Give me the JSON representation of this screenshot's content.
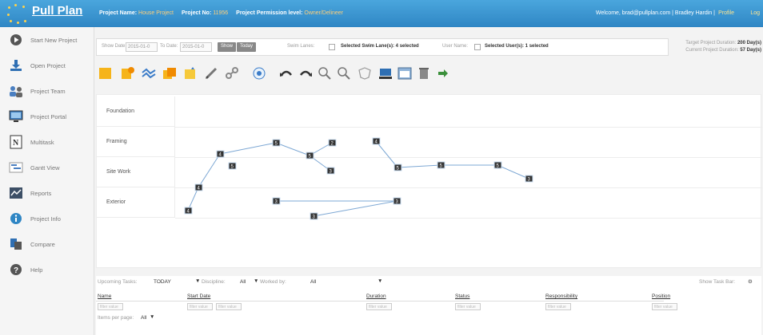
{
  "header": {
    "logo_text": "Pull Plan",
    "project_name_label": "Project Name:",
    "project_name": "House Project",
    "project_no_label": "Project No:",
    "project_no": "11956",
    "permission_label": "Project Permission level:",
    "permission": "Owner/Delineer",
    "welcome": "Welcome, brad@pullplan.com | Bradley Hardin |",
    "profile": "Profile",
    "logout": "Log"
  },
  "sidebar": {
    "items": [
      {
        "label": "Start New Project",
        "icon": "play-icon"
      },
      {
        "label": "Open Project",
        "icon": "download-icon"
      },
      {
        "label": "Project Team",
        "icon": "team-icon"
      },
      {
        "label": "Project Portal",
        "icon": "monitor-icon"
      },
      {
        "label": "Multitask",
        "icon": "multitask-icon"
      },
      {
        "label": "Gantt View",
        "icon": "gantt-icon"
      },
      {
        "label": "Reports",
        "icon": "reports-icon"
      },
      {
        "label": "Project Info",
        "icon": "info-icon"
      },
      {
        "label": "Compare",
        "icon": "compare-icon"
      },
      {
        "label": "Help",
        "icon": "help-icon"
      }
    ]
  },
  "filters": {
    "show_date_label": "Show Date:",
    "from_date": "2015-01-0",
    "to_label": "To Date:",
    "to_date": "2015-01-0",
    "show_btn": "Show",
    "today_btn": "Today",
    "swim_lanes_label": "Swim Lanes:",
    "swim_lanes_selected": "Selected Swim Lane(s): 4 selected",
    "user_names_label": "User Name:",
    "users_selected": "Selected User(s): 1 selected",
    "target_duration_label": "Target Project Duration:",
    "target_duration": "200 Day(s)",
    "current_duration_label": "Current Project Duration:",
    "current_duration": "57 Day(s)"
  },
  "lanes": [
    "Foundation",
    "Framing",
    "Site Work",
    "Exterior"
  ],
  "tasks": [
    {
      "lane": 2,
      "label": "4"
    },
    {
      "lane": 1,
      "label": "4"
    },
    {
      "lane": 0,
      "label": "4"
    },
    {
      "lane": 1,
      "label": "5"
    },
    {
      "lane": 0,
      "label": "5"
    },
    {
      "lane": 0,
      "label": "5"
    },
    {
      "lane": 0,
      "label": "2"
    },
    {
      "lane": 1,
      "label": "3"
    },
    {
      "lane": 0,
      "label": "4"
    },
    {
      "lane": 1,
      "label": "5"
    },
    {
      "lane": 1,
      "label": "5"
    },
    {
      "lane": 1,
      "label": "5"
    },
    {
      "lane": 1,
      "label": "3"
    },
    {
      "lane": 2,
      "label": "3"
    },
    {
      "lane": 2,
      "label": "3"
    },
    {
      "lane": 2,
      "label": "3"
    }
  ],
  "upcoming": {
    "label": "Upcoming Tasks:",
    "period": "TODAY",
    "discipline_label": "Discipline:",
    "discipline": "All",
    "worked_by_label": "Worked by:",
    "worked_by": "All",
    "show_task_bar": "Show Task Bar:",
    "columns": [
      "Name",
      "Start Date",
      "Duration",
      "Status",
      "Responsibility",
      "Position"
    ],
    "filter_placeholder": "filter value",
    "items_per_page_label": "Items per page:",
    "items_per_page": "All"
  }
}
